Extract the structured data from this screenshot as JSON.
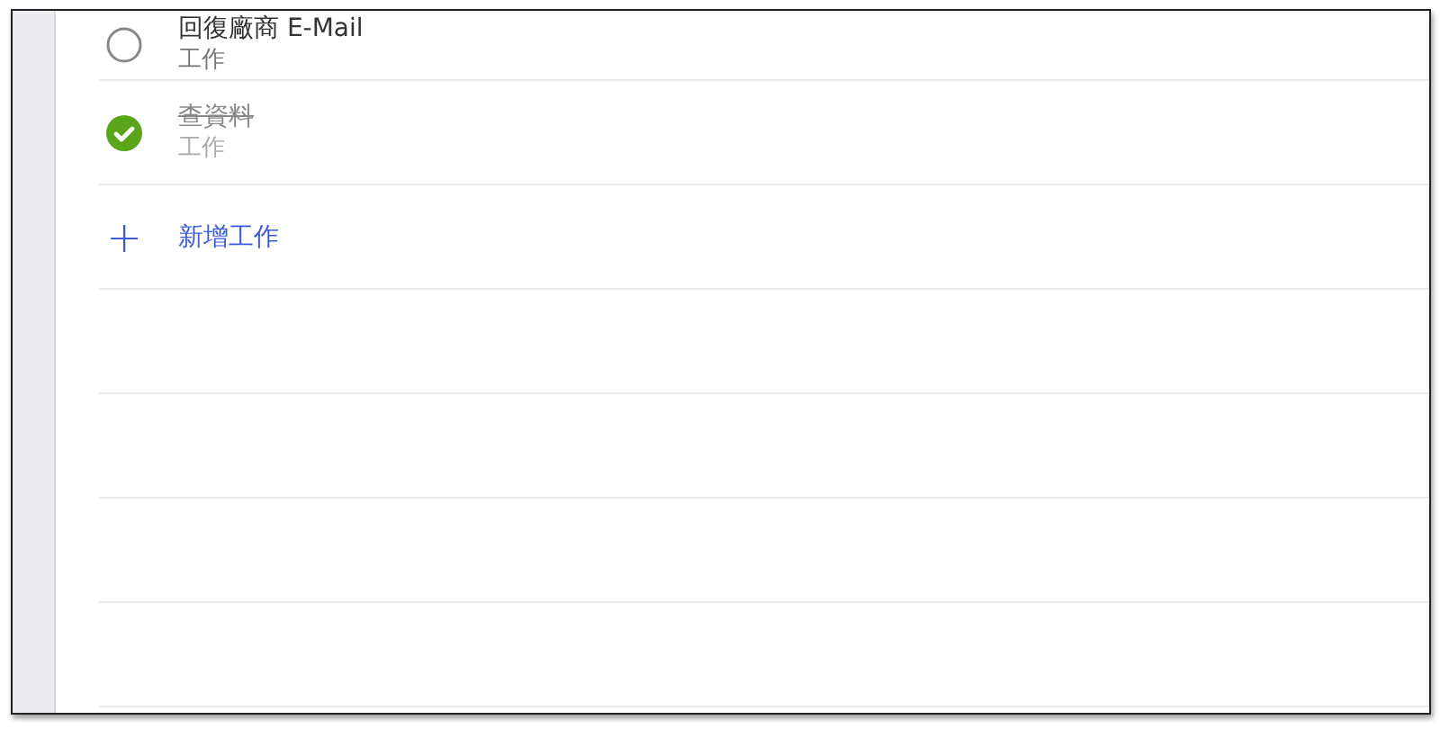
{
  "tasks": [
    {
      "title": "回復廠商 E-Mail",
      "list": "工作",
      "completed": false
    },
    {
      "title": "查資料",
      "list": "工作",
      "completed": true
    }
  ],
  "add_task": {
    "icon": "+",
    "label": "新增工作"
  }
}
